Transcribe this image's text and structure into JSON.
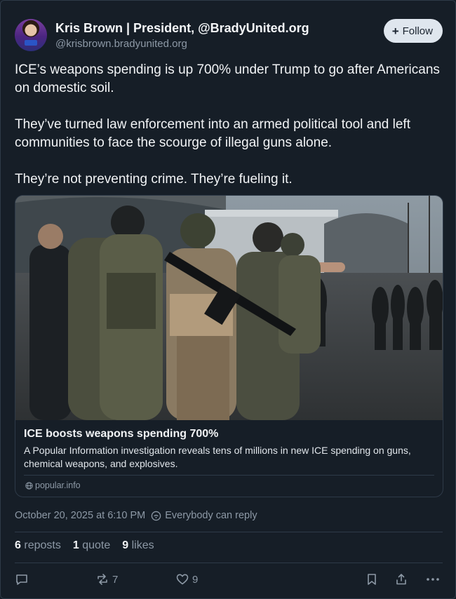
{
  "author": {
    "name": "Kris Brown | President, @BradyUnited.org",
    "handle": "@krisbrown.bradyunited.org",
    "follow_label": "Follow"
  },
  "post": {
    "paragraphs": [
      "ICE’s weapons spending is up 700% under Trump to go after Americans on domestic soil.",
      "They’ve turned law enforcement into an armed political tool and left communities to face the scourge of illegal guns alone.",
      "They’re not preventing crime. They’re fueling it."
    ]
  },
  "link_card": {
    "image_icon": "photo-armed-agents-street",
    "title": "ICE boosts weapons spending 700%",
    "description": "A Popular Information investigation reveals tens of millions in new ICE spending on guns, chemical weapons, and explosives.",
    "domain": "popular.info"
  },
  "meta": {
    "timestamp": "October 20, 2025 at 6:10 PM",
    "reply_setting": "Everybody can reply"
  },
  "stats": {
    "reposts_count": "6",
    "reposts_label": "reposts",
    "quotes_count": "1",
    "quotes_label": "quote",
    "likes_count": "9",
    "likes_label": "likes"
  },
  "actions": {
    "repost_count": "7",
    "like_count": "9"
  },
  "colors": {
    "background": "#161e27",
    "text": "#f1f3f5",
    "muted": "#8d99a6",
    "border": "#2e3a48",
    "follow_bg": "#dfe6ee"
  }
}
